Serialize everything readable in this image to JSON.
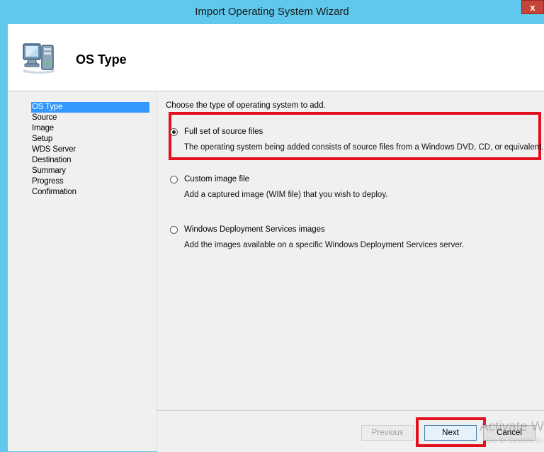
{
  "window": {
    "title": "Import Operating System Wizard",
    "close_glyph": "x"
  },
  "header": {
    "title": "OS Type",
    "icon": "computer-icon"
  },
  "steps": [
    {
      "label": "OS Type",
      "active": true
    },
    {
      "label": "Source",
      "active": false
    },
    {
      "label": "Image",
      "active": false
    },
    {
      "label": "Setup",
      "active": false
    },
    {
      "label": "WDS Server",
      "active": false
    },
    {
      "label": "Destination",
      "active": false
    },
    {
      "label": "Summary",
      "active": false
    },
    {
      "label": "Progress",
      "active": false
    },
    {
      "label": "Confirmation",
      "active": false
    }
  ],
  "content": {
    "prompt": "Choose the type of operating system to add.",
    "options": [
      {
        "label": "Full set of source files",
        "description": "The operating system being added consists of source files from a Windows DVD, CD, or equivalent.",
        "selected": true
      },
      {
        "label": "Custom image file",
        "description": "Add a captured image (WIM file) that you wish to deploy.",
        "selected": false
      },
      {
        "label": "Windows Deployment Services images",
        "description": "Add the images available on a specific Windows Deployment Services server.",
        "selected": false
      }
    ]
  },
  "buttons": {
    "previous": "Previous",
    "next": "Next",
    "cancel": "Cancel"
  },
  "watermark": {
    "text": "Activate Wir",
    "subtext": "Go to System in"
  },
  "colors": {
    "titlebar": "#5fc8ec",
    "selection": "#3399ff",
    "highlight": "#e3111d",
    "close": "#c7443a"
  }
}
